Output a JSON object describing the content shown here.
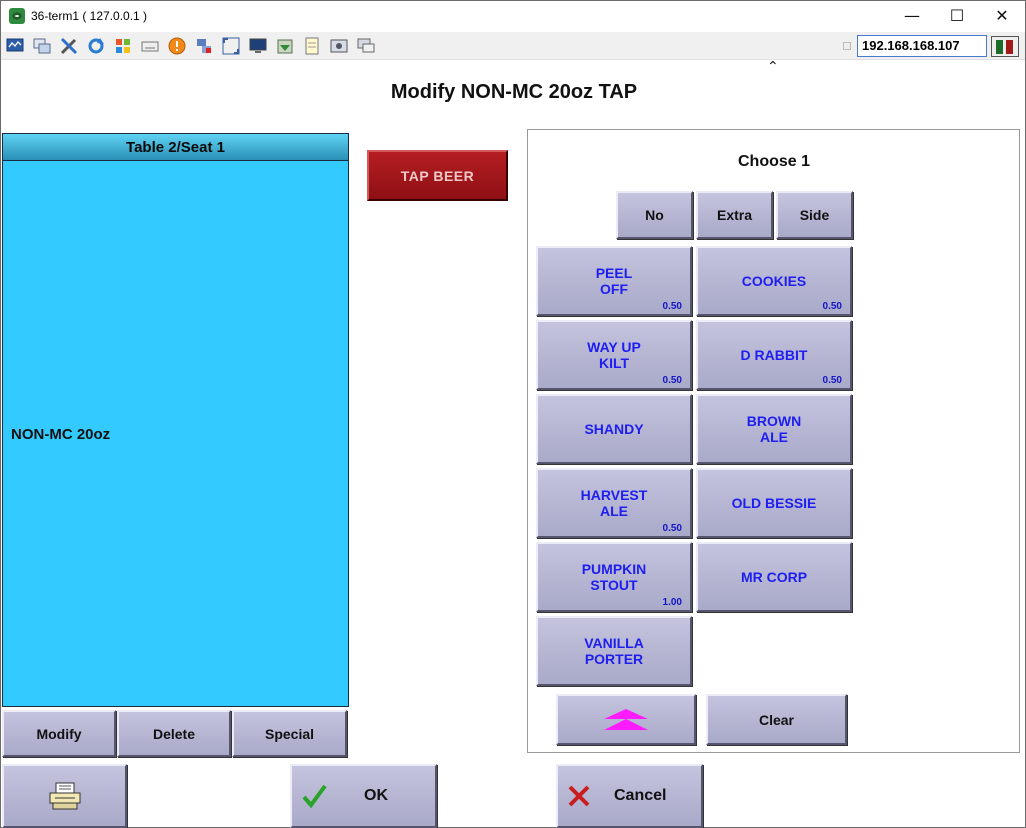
{
  "window": {
    "title": "36-term1 ( 127.0.0.1 )",
    "minimize": "—",
    "maximize": "☐",
    "close": "✕"
  },
  "toolbar": {
    "ip_address": "192.168.168.107",
    "icons": [
      "monitor-icon",
      "windows-icon",
      "tools-icon",
      "refresh-icon",
      "flag-icon",
      "keyboard-icon",
      "alert-icon",
      "network-icon",
      "fullscreen-icon",
      "display-icon",
      "download-icon",
      "notepad-icon",
      "screenshot-icon",
      "chat-icon"
    ]
  },
  "page": {
    "title": "Modify NON-MC 20oz TAP"
  },
  "order": {
    "header": "Table 2/Seat 1",
    "item": "NON-MC 20oz",
    "modify_label": "Modify",
    "delete_label": "Delete",
    "special_label": "Special"
  },
  "category": {
    "label": "TAP BEER"
  },
  "modifiers": {
    "choose_label": "Choose 1",
    "no_label": "No",
    "extra_label": "Extra",
    "side_label": "Side",
    "items": [
      {
        "line1": "PEEL",
        "line2": "OFF",
        "price": "0.50"
      },
      {
        "line1": "COOKIES",
        "line2": "",
        "price": "0.50"
      },
      {
        "line1": "WAY UP",
        "line2": "KILT",
        "price": "0.50"
      },
      {
        "line1": "D RABBIT",
        "line2": "",
        "price": "0.50"
      },
      {
        "line1": "SHANDY",
        "line2": "",
        "price": ""
      },
      {
        "line1": "BROWN",
        "line2": "ALE",
        "price": ""
      },
      {
        "line1": "HARVEST",
        "line2": "ALE",
        "price": "0.50"
      },
      {
        "line1": "OLD BESSIE",
        "line2": "",
        "price": ""
      },
      {
        "line1": "PUMPKIN",
        "line2": "STOUT",
        "price": "1.00"
      },
      {
        "line1": "MR CORP",
        "line2": "",
        "price": ""
      },
      {
        "line1": "VANILLA",
        "line2": "PORTER",
        "price": ""
      }
    ],
    "clear_label": "Clear",
    "scroll_color": "#ff1aff"
  },
  "footer": {
    "ok_label": "OK",
    "cancel_label": "Cancel"
  },
  "colors": {
    "order_bg": "#33cbff",
    "button_face": "#b8b8d6",
    "item_text": "#1e1ef0",
    "tap_beer": "#a0171b",
    "ok_check": "#28a428",
    "cancel_x": "#c81e1e"
  }
}
